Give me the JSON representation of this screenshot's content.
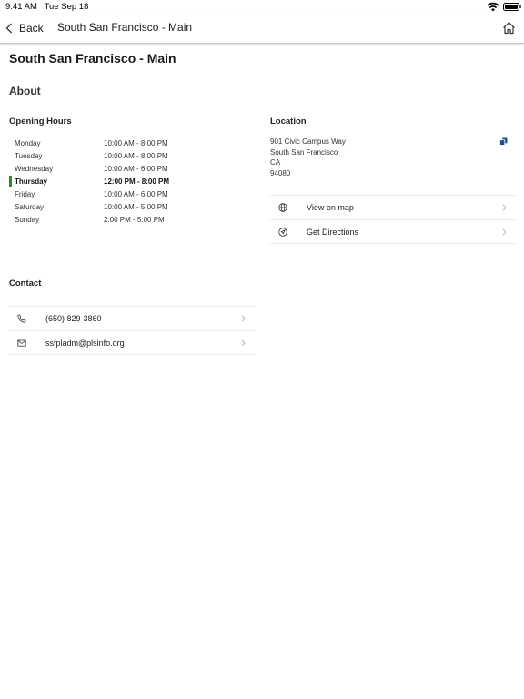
{
  "status": {
    "time": "9:41 AM   Tue Sep 18"
  },
  "nav": {
    "back_label": "Back",
    "title": "South San Francisco - Main"
  },
  "page": {
    "title": "South San Francisco - Main",
    "about_heading": "About"
  },
  "hours": {
    "heading": "Opening Hours",
    "rows": [
      {
        "day": "Monday",
        "time": "10:00 AM - 8:00 PM"
      },
      {
        "day": "Tuesday",
        "time": "10:00 AM - 8:00 PM"
      },
      {
        "day": "Wednesday",
        "time": "10:00 AM - 6:00 PM"
      },
      {
        "day": "Thursday",
        "time": "12:00 PM - 8:00 PM"
      },
      {
        "day": "Friday",
        "time": "10:00 AM - 6:00 PM"
      },
      {
        "day": "Saturday",
        "time": "10:00 AM - 5:00 PM"
      },
      {
        "day": "Sunday",
        "time": "2:00 PM - 5:00 PM"
      }
    ]
  },
  "location": {
    "heading": "Location",
    "address_lines": [
      "901 Civic Campus Way",
      "South San Francisco",
      "CA",
      "94080"
    ],
    "actions": [
      {
        "label": "View on map",
        "icon": "globe-icon"
      },
      {
        "label": "Get Directions",
        "icon": "directions-icon"
      }
    ]
  },
  "contact": {
    "heading": "Contact",
    "actions": [
      {
        "label": "(650) 829-3860",
        "icon": "phone-icon"
      },
      {
        "label": "ssfpladm@plsinfo.org",
        "icon": "email-icon"
      }
    ]
  },
  "colors": {
    "today_marker": "#2e8b2e",
    "copy_icon": "#1f4e8c"
  }
}
